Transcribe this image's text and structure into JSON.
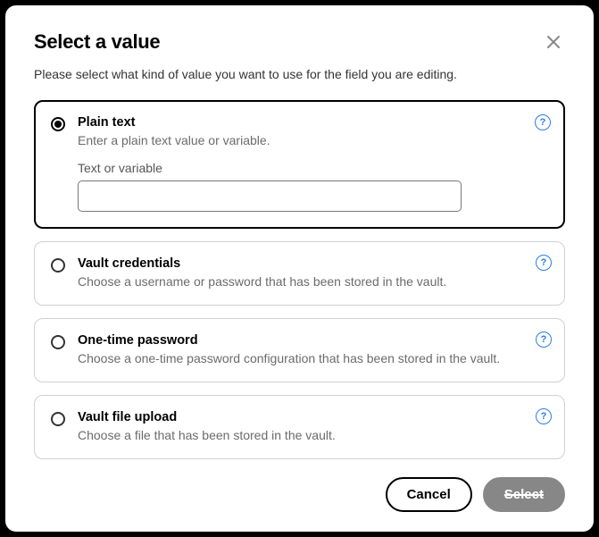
{
  "dialog": {
    "title": "Select a value",
    "subtitle": "Please select what kind of value you want to use for the field you are editing."
  },
  "options": {
    "plain_text": {
      "title": "Plain text",
      "desc": "Enter a plain text value or variable.",
      "input_label": "Text or variable",
      "input_value": ""
    },
    "vault_credentials": {
      "title": "Vault credentials",
      "desc": "Choose a username or password that has been stored in the vault."
    },
    "otp": {
      "title": "One-time password",
      "desc": "Choose a one-time password configuration that has been stored in the vault."
    },
    "vault_file": {
      "title": "Vault file upload",
      "desc": "Choose a file that has been stored in the vault."
    }
  },
  "help_glyph": "?",
  "buttons": {
    "cancel": "Cancel",
    "select": "Select"
  }
}
